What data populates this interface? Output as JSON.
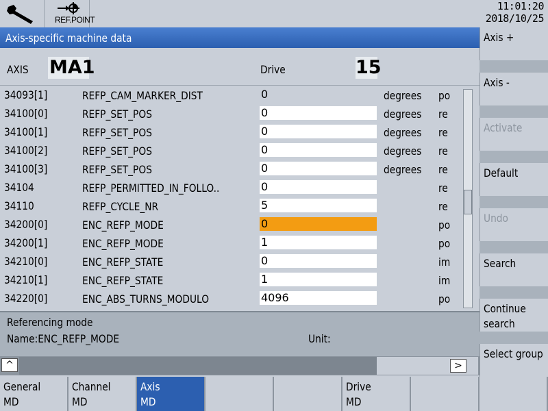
{
  "topbar": {
    "tool_icon": "wrench-icon",
    "refpoint": {
      "icon": "reference-point-icon",
      "label": "REF.POINT"
    },
    "time": "11:01:20",
    "date": "2018/10/25"
  },
  "title": "Axis-specific machine data",
  "axis": {
    "label": "AXIS",
    "value": "MA1",
    "drive_label": "Drive",
    "drive_value": "15"
  },
  "rows": [
    {
      "num": "34093[1]",
      "name": "REFP_CAM_MARKER_DIST",
      "value": "0",
      "unit": "degrees",
      "act": "po"
    },
    {
      "num": "34100[0]",
      "name": "REFP_SET_POS",
      "value": "0",
      "unit": "degrees",
      "act": "re"
    },
    {
      "num": "34100[1]",
      "name": "REFP_SET_POS",
      "value": "0",
      "unit": "degrees",
      "act": "re"
    },
    {
      "num": "34100[2]",
      "name": "REFP_SET_POS",
      "value": "0",
      "unit": "degrees",
      "act": "re"
    },
    {
      "num": "34100[3]",
      "name": "REFP_SET_POS",
      "value": "0",
      "unit": "degrees",
      "act": "re"
    },
    {
      "num": "34104",
      "name": "REFP_PERMITTED_IN_FOLLO..",
      "value": "0",
      "unit": "",
      "act": "re"
    },
    {
      "num": "34110",
      "name": "REFP_CYCLE_NR",
      "value": "5",
      "unit": "",
      "act": "re"
    },
    {
      "num": "34200[0]",
      "name": "ENC_REFP_MODE",
      "value": "0",
      "unit": "",
      "act": "po"
    },
    {
      "num": "34200[1]",
      "name": "ENC_REFP_MODE",
      "value": "1",
      "unit": "",
      "act": "po"
    },
    {
      "num": "34210[0]",
      "name": "ENC_REFP_STATE",
      "value": "0",
      "unit": "",
      "act": "im"
    },
    {
      "num": "34210[1]",
      "name": "ENC_REFP_STATE",
      "value": "1",
      "unit": "",
      "act": "im"
    },
    {
      "num": "34220[0]",
      "name": "ENC_ABS_TURNS_MODULO",
      "value": "4096",
      "unit": "",
      "act": "po"
    }
  ],
  "selected_row_index": 7,
  "colors": {
    "highlight": "#f39c12",
    "title_bar": "#2c5fb0"
  },
  "info": {
    "title": "Referencing mode",
    "name": "Name:ENC_REFP_MODE",
    "unit_label": "Unit:"
  },
  "scroll": {
    "up_symbol": "^",
    "next_symbol": ">"
  },
  "right_softkeys": [
    {
      "label": "Axis +",
      "enabled": true
    },
    {
      "label": "Axis -",
      "enabled": true
    },
    {
      "label": "Activate",
      "enabled": false
    },
    {
      "label": "Default",
      "enabled": true
    },
    {
      "label": "Undo",
      "enabled": false
    },
    {
      "label": "Search",
      "enabled": true
    },
    {
      "label": "Continue search",
      "enabled": true
    },
    {
      "label": "Select group",
      "enabled": true
    }
  ],
  "bottom_softkeys": [
    {
      "line1": "General",
      "line2": "MD",
      "active": false
    },
    {
      "line1": "Channel",
      "line2": "MD",
      "active": false
    },
    {
      "line1": "Axis",
      "line2": "MD",
      "active": true
    },
    {
      "line1": "",
      "line2": "",
      "active": false
    },
    {
      "line1": "",
      "line2": "",
      "active": false
    },
    {
      "line1": "Drive",
      "line2": "MD",
      "active": false
    },
    {
      "line1": "",
      "line2": "",
      "active": false
    },
    {
      "line1": "",
      "line2": "",
      "active": false
    }
  ]
}
